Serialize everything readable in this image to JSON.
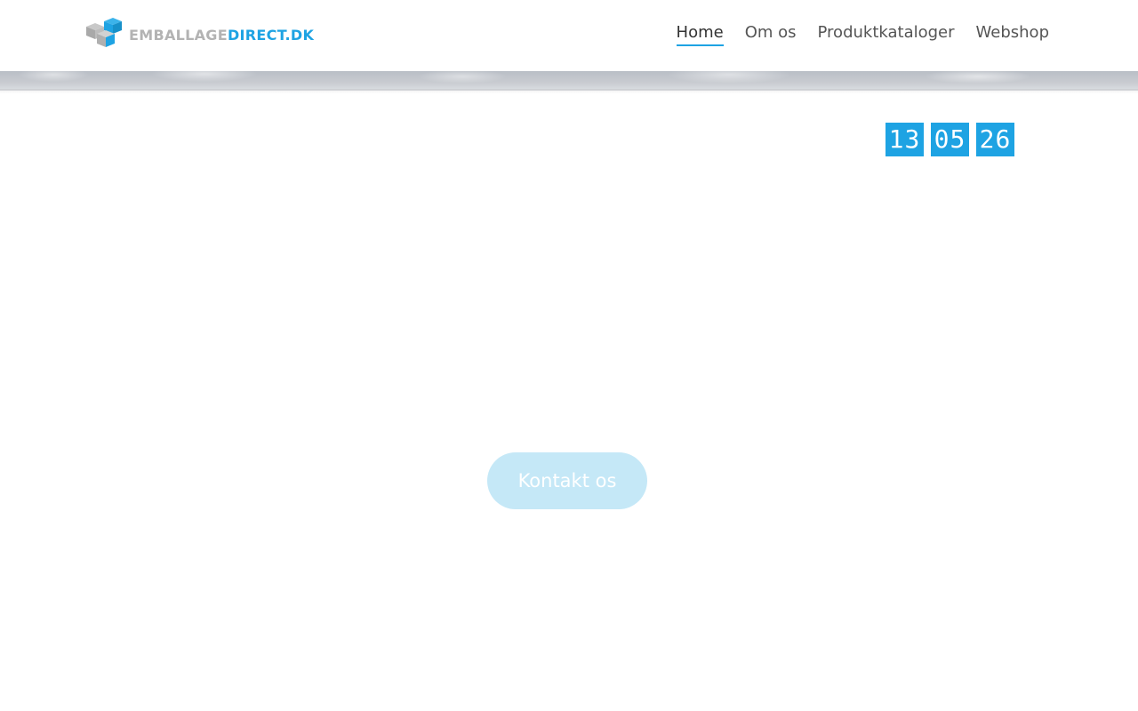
{
  "brand": {
    "logo_part1": "EMBALLAGE",
    "logo_part2": "DIRECT.DK",
    "colors": {
      "gray": "#b3b3b3",
      "blue": "#1ea3e3"
    }
  },
  "nav": {
    "items": [
      {
        "label": "Home",
        "active": true
      },
      {
        "label": "Om os",
        "active": false
      },
      {
        "label": "Produktkataloger",
        "active": false
      },
      {
        "label": "Webshop",
        "active": false
      }
    ]
  },
  "clock": {
    "hours": "13",
    "minutes": "05",
    "seconds": "26",
    "color": "#1ea3e3"
  },
  "hero": {
    "cta_label": "Kontakt os",
    "cta_color": "#c5e8f7"
  },
  "icons": {
    "logo": "box-icon"
  }
}
